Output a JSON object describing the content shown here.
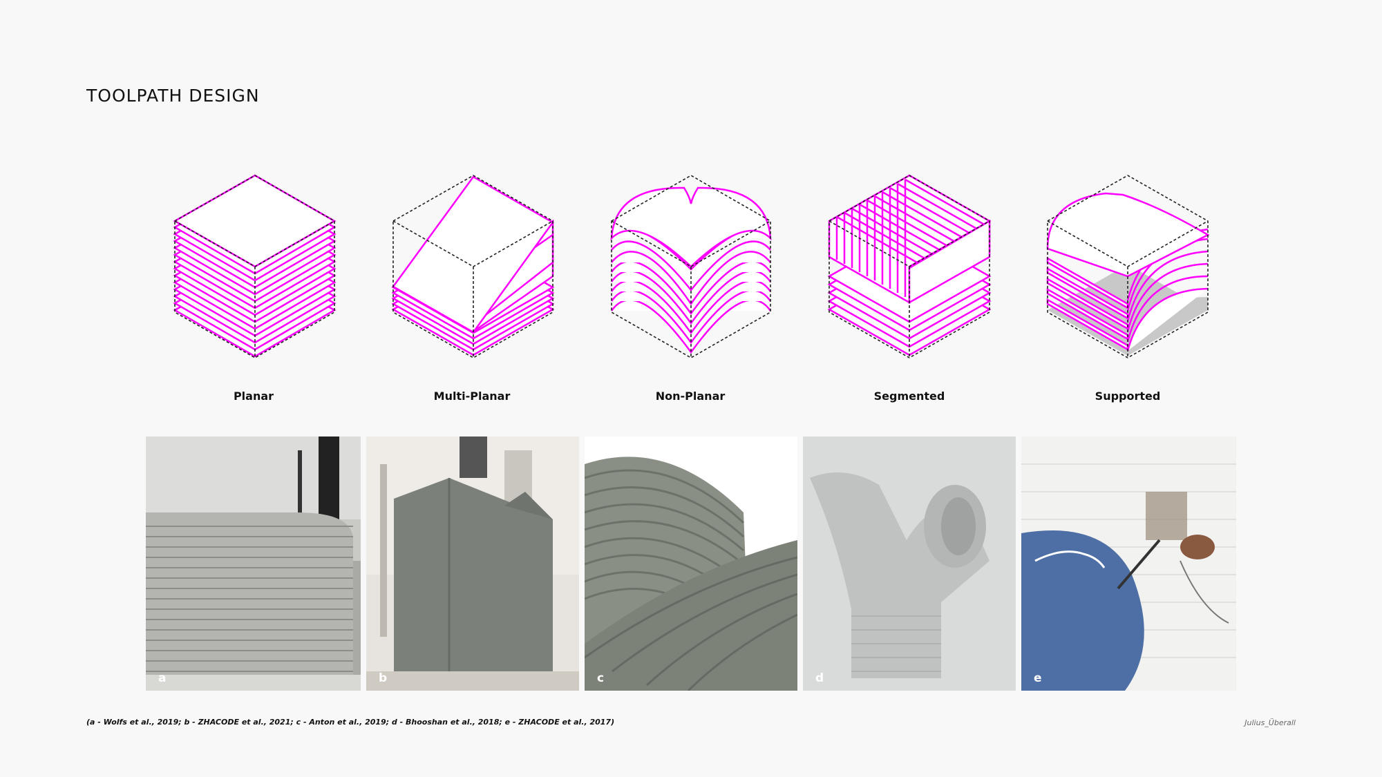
{
  "title": "TOOLPATH DESIGN",
  "accent_color": "#ff00ff",
  "categories": [
    {
      "label": "Planar",
      "icon": "planar-cube-icon"
    },
    {
      "label": "Multi-Planar",
      "icon": "multi-planar-cube-icon"
    },
    {
      "label": "Non-Planar",
      "icon": "non-planar-cube-icon"
    },
    {
      "label": "Segmented",
      "icon": "segmented-cube-icon"
    },
    {
      "label": "Supported",
      "icon": "supported-cube-icon"
    }
  ],
  "photos": [
    {
      "label": "a"
    },
    {
      "label": "b"
    },
    {
      "label": "c"
    },
    {
      "label": "d"
    },
    {
      "label": "e"
    }
  ],
  "citation": "(a - Wolfs et al., 2019; b - ZHACODE et al., 2021; c - Anton et al., 2019; d - Bhooshan et al., 2018; e - ZHACODE et al., 2017)",
  "author": "Julius_Überall"
}
